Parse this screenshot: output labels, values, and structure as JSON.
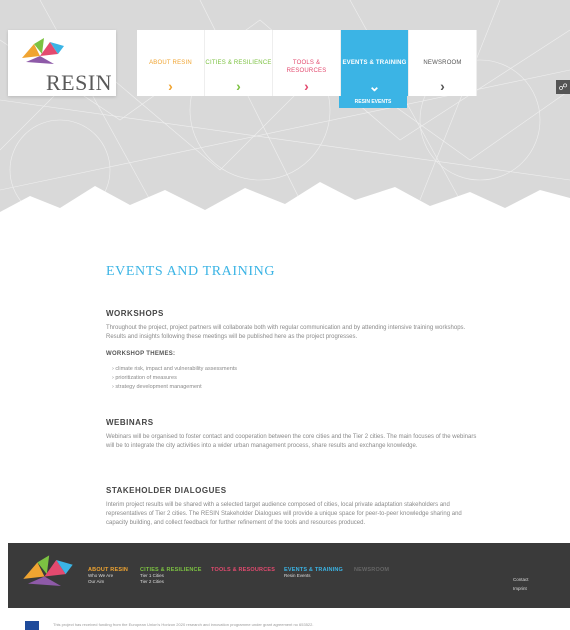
{
  "brand": {
    "name": "RESIN"
  },
  "nav": {
    "items": [
      {
        "label": "ABOUT RESIN",
        "color": "#f0a431"
      },
      {
        "label": "CITIES & RESILIENCE",
        "color": "#7cc242"
      },
      {
        "label": "TOOLS & RESOURCES",
        "color": "#e34a6f"
      },
      {
        "label": "EVENTS & TRAINING",
        "color": "#3bb4e5"
      },
      {
        "label": "NEWSROOM",
        "color": "#555555"
      }
    ],
    "active_sub": "RESIN EVENTS"
  },
  "page": {
    "title": "EVENTS AND TRAINING",
    "workshops": {
      "heading": "WORKSHOPS",
      "text": "Throughout the project, project partners will collaborate both with regular communication and by attending intensive training workshops. Results and insights following these meetings will be published here as the project progresses.",
      "themes_heading": "WORKSHOP THEMES:",
      "themes": [
        "climate risk, impact and vulnerability assessments",
        "prioritization of measures",
        "strategy development management"
      ]
    },
    "webinars": {
      "heading": "WEBINARS",
      "text": "Webinars will be organised to foster contact and cooperation between the core cities and the Tier 2 cities. The main focuses of the webinars will be to integrate the city activities into a wider urban management process, share results and exchange knowledge."
    },
    "dialogues": {
      "heading": "STAKEHOLDER DIALOGUES",
      "text": "Interim project results will be shared with a selected target audience composed of cities, local private adaptation stakeholders and representatives of Tier 2 cities. The RESIN Stakeholder Dialogues will provide a unique space for peer-to-peer knowledge sharing and capacity building, and collect feedback for further refinement of the tools and resources produced."
    }
  },
  "footer": {
    "columns": [
      {
        "heading": "ABOUT RESIN",
        "color": "#f0a431",
        "links": [
          "Who We Are",
          "Our Aim"
        ]
      },
      {
        "heading": "CITIES & RESILIENCE",
        "color": "#7cc242",
        "links": [
          "Tier 1 Cities",
          "Tier 2 Cities"
        ]
      },
      {
        "heading": "TOOLS & RESOURCES",
        "color": "#e34a6f",
        "links": []
      },
      {
        "heading": "EVENTS & TRAINING",
        "color": "#3bb4e5",
        "links": [
          "Resin Events"
        ]
      },
      {
        "heading": "NEWSROOM",
        "color": "#666666",
        "links": []
      }
    ],
    "right_links": [
      "Contact",
      "Imprint"
    ],
    "funding_text": "This project has received funding from the European Union's Horizon 2020 research and innovation programme under grant agreement no 653522."
  }
}
